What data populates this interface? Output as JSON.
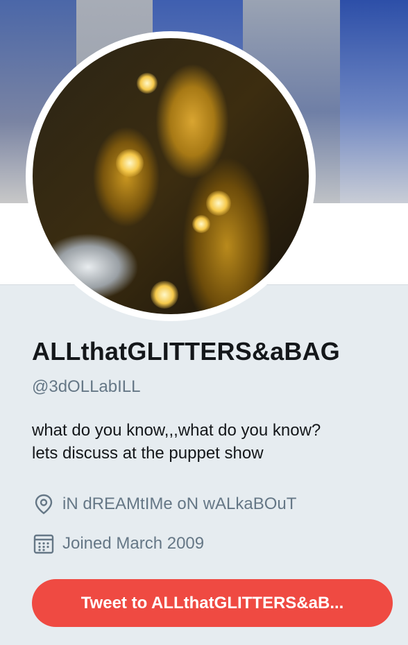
{
  "profile": {
    "name": "ALLthatGLITTERS&aBAG",
    "handle": "@3dOLLabILL",
    "bio_line1": "what do you know,,,what do you know?",
    "bio_line2": "lets discuss at the puppet show",
    "location": "iN dREAMtIMe oN wALkaBOuT",
    "joined": "Joined March 2009"
  },
  "actions": {
    "tweet_to_label": "Tweet to ALLthatGLITTERS&aB..."
  },
  "icons": {
    "location": "location-pin-icon",
    "joined": "calendar-icon"
  },
  "colors": {
    "accent_button": "#ef4a42",
    "secondary_text": "#657786",
    "primary_text": "#14171a",
    "background": "#e6ecf0"
  }
}
